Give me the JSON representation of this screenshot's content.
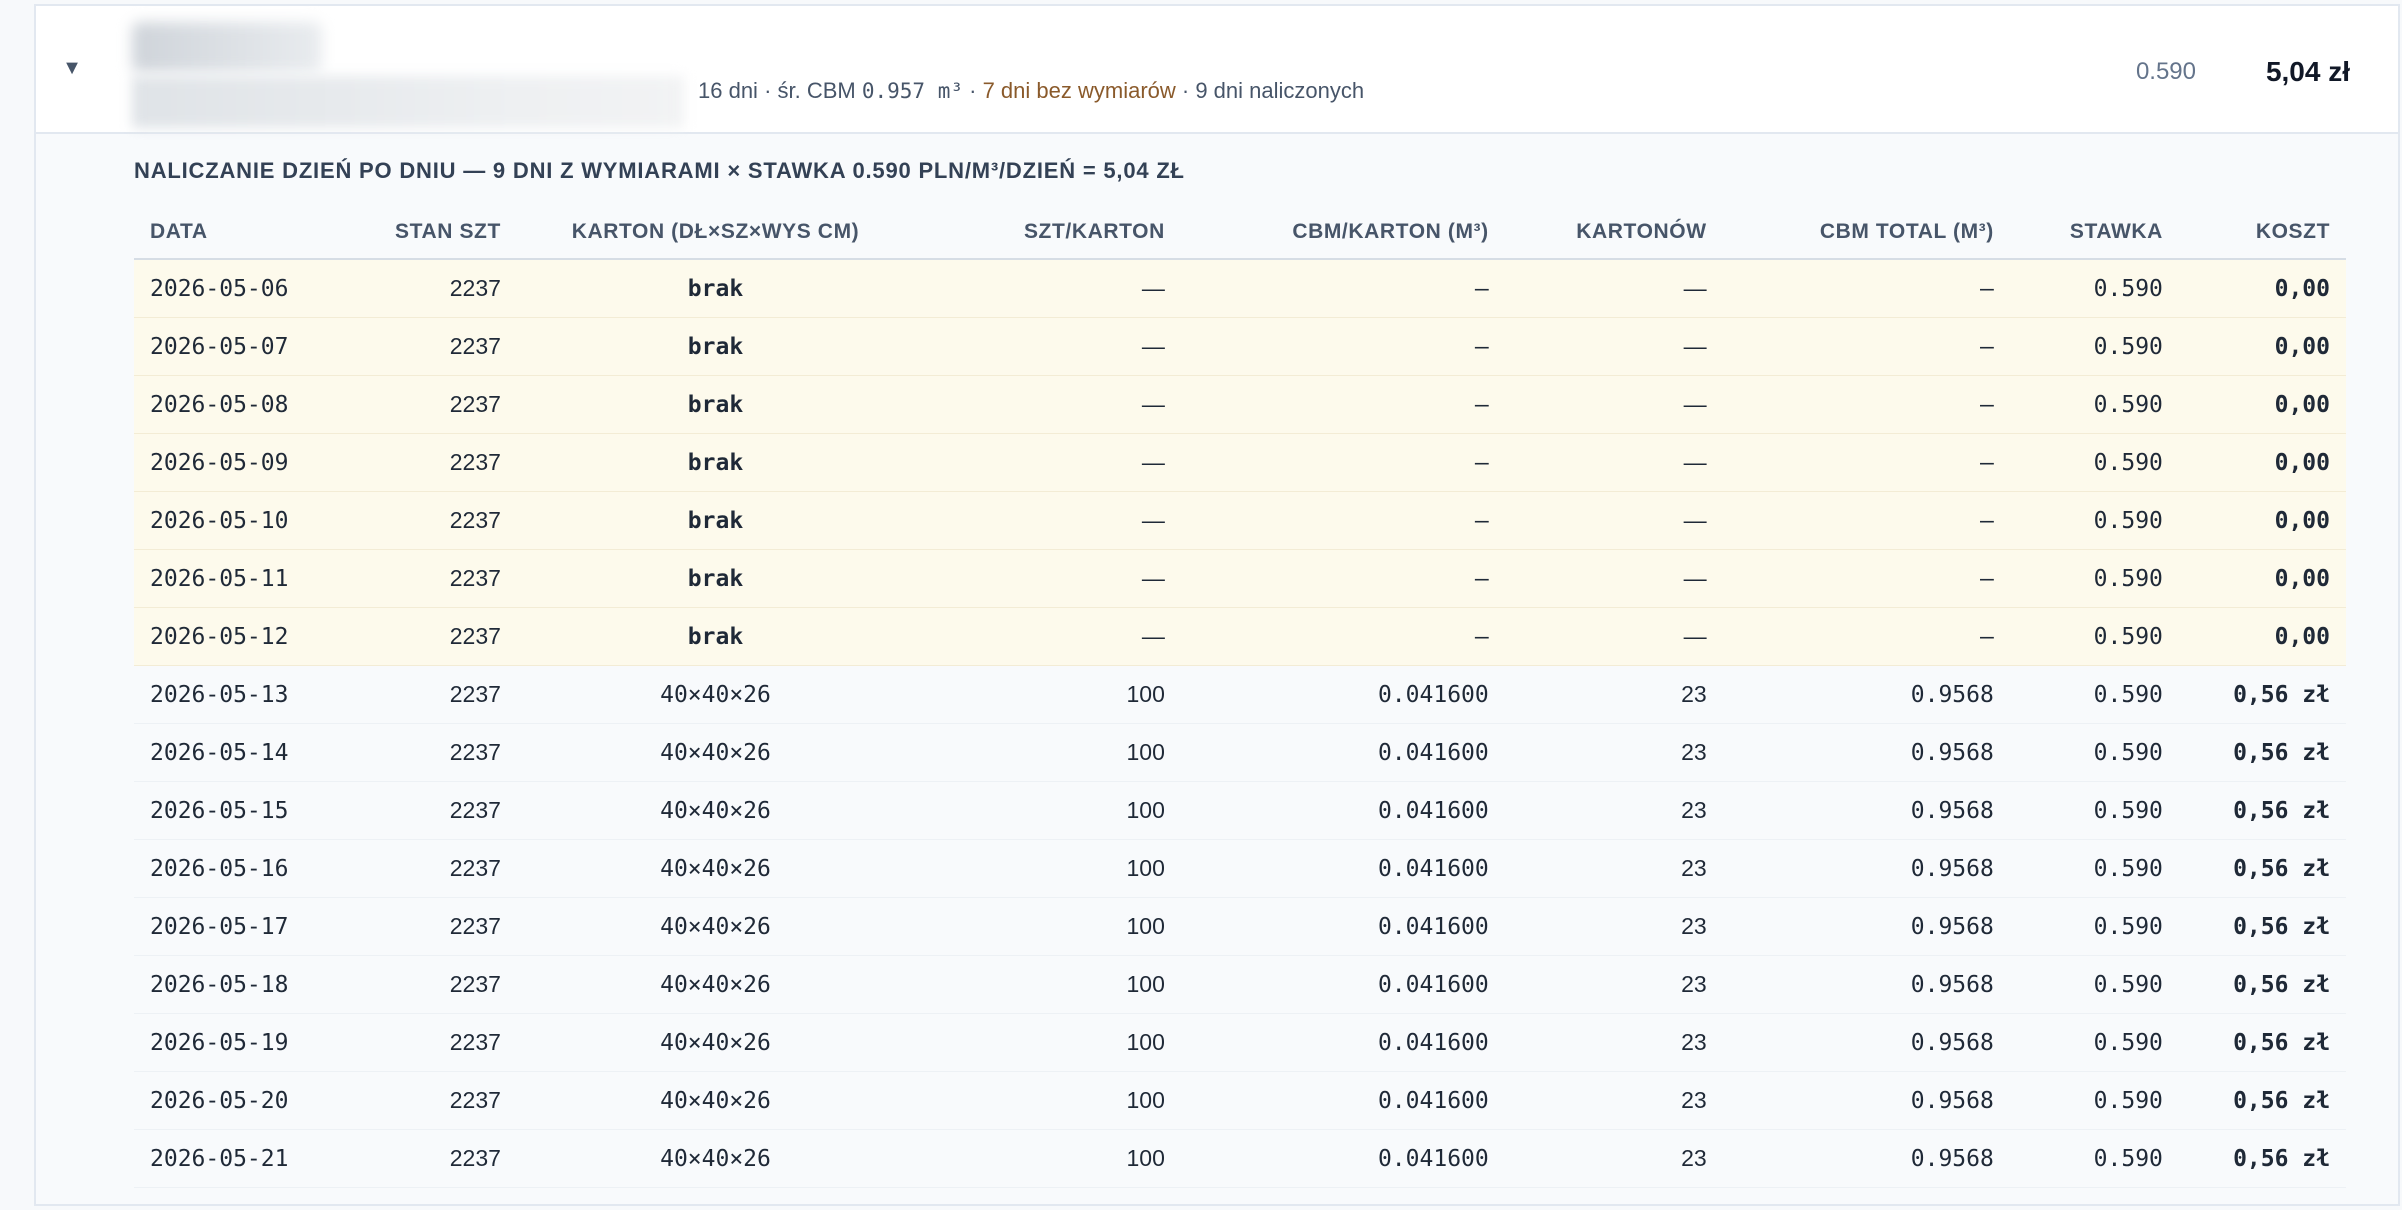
{
  "header": {
    "toggle_glyph": "▼",
    "summary_days": "16 dni",
    "summary_sep1": " · ",
    "summary_avg_label": "śr. CBM ",
    "summary_avg_value": "0.957 m³",
    "summary_sep2": " · ",
    "summary_missing": "7 dni bez wymiarów",
    "summary_sep3": " · ",
    "summary_charged": "9 dni naliczonych",
    "rate": "0.590",
    "total": "5,04 zł"
  },
  "breakdown": {
    "title": "NALICZANIE DZIEŃ PO DNIU — 9 DNI Z WYMIARAMI × STAWKA 0.590 PLN/M³/DZIEŃ = 5,04 ZŁ",
    "columns": [
      "DATA",
      "STAN SZT",
      "KARTON (DŁ×SZ×WYS CM)",
      "SZT/KARTON",
      "CBM/KARTON (M³)",
      "KARTONÓW",
      "CBM TOTAL (M³)",
      "STAWKA",
      "KOSZT"
    ],
    "rows": [
      {
        "date": "2026-05-06",
        "stock": "2237",
        "carton": "brak",
        "per_carton": "—",
        "cbm_carton": "–",
        "cartons": "—",
        "cbm_total": "–",
        "rate": "0.590",
        "cost": "0,00"
      },
      {
        "date": "2026-05-07",
        "stock": "2237",
        "carton": "brak",
        "per_carton": "—",
        "cbm_carton": "–",
        "cartons": "—",
        "cbm_total": "–",
        "rate": "0.590",
        "cost": "0,00"
      },
      {
        "date": "2026-05-08",
        "stock": "2237",
        "carton": "brak",
        "per_carton": "—",
        "cbm_carton": "–",
        "cartons": "—",
        "cbm_total": "–",
        "rate": "0.590",
        "cost": "0,00"
      },
      {
        "date": "2026-05-09",
        "stock": "2237",
        "carton": "brak",
        "per_carton": "—",
        "cbm_carton": "–",
        "cartons": "—",
        "cbm_total": "–",
        "rate": "0.590",
        "cost": "0,00"
      },
      {
        "date": "2026-05-10",
        "stock": "2237",
        "carton": "brak",
        "per_carton": "—",
        "cbm_carton": "–",
        "cartons": "—",
        "cbm_total": "–",
        "rate": "0.590",
        "cost": "0,00"
      },
      {
        "date": "2026-05-11",
        "stock": "2237",
        "carton": "brak",
        "per_carton": "—",
        "cbm_carton": "–",
        "cartons": "—",
        "cbm_total": "–",
        "rate": "0.590",
        "cost": "0,00"
      },
      {
        "date": "2026-05-12",
        "stock": "2237",
        "carton": "brak",
        "per_carton": "—",
        "cbm_carton": "–",
        "cartons": "—",
        "cbm_total": "–",
        "rate": "0.590",
        "cost": "0,00"
      },
      {
        "date": "2026-05-13",
        "stock": "2237",
        "carton": "40×40×26",
        "per_carton": "100",
        "cbm_carton": "0.041600",
        "cartons": "23",
        "cbm_total": "0.9568",
        "rate": "0.590",
        "cost": "0,56 zł"
      },
      {
        "date": "2026-05-14",
        "stock": "2237",
        "carton": "40×40×26",
        "per_carton": "100",
        "cbm_carton": "0.041600",
        "cartons": "23",
        "cbm_total": "0.9568",
        "rate": "0.590",
        "cost": "0,56 zł"
      },
      {
        "date": "2026-05-15",
        "stock": "2237",
        "carton": "40×40×26",
        "per_carton": "100",
        "cbm_carton": "0.041600",
        "cartons": "23",
        "cbm_total": "0.9568",
        "rate": "0.590",
        "cost": "0,56 zł"
      },
      {
        "date": "2026-05-16",
        "stock": "2237",
        "carton": "40×40×26",
        "per_carton": "100",
        "cbm_carton": "0.041600",
        "cartons": "23",
        "cbm_total": "0.9568",
        "rate": "0.590",
        "cost": "0,56 zł"
      },
      {
        "date": "2026-05-17",
        "stock": "2237",
        "carton": "40×40×26",
        "per_carton": "100",
        "cbm_carton": "0.041600",
        "cartons": "23",
        "cbm_total": "0.9568",
        "rate": "0.590",
        "cost": "0,56 zł"
      },
      {
        "date": "2026-05-18",
        "stock": "2237",
        "carton": "40×40×26",
        "per_carton": "100",
        "cbm_carton": "0.041600",
        "cartons": "23",
        "cbm_total": "0.9568",
        "rate": "0.590",
        "cost": "0,56 zł"
      },
      {
        "date": "2026-05-19",
        "stock": "2237",
        "carton": "40×40×26",
        "per_carton": "100",
        "cbm_carton": "0.041600",
        "cartons": "23",
        "cbm_total": "0.9568",
        "rate": "0.590",
        "cost": "0,56 zł"
      },
      {
        "date": "2026-05-20",
        "stock": "2237",
        "carton": "40×40×26",
        "per_carton": "100",
        "cbm_carton": "0.041600",
        "cartons": "23",
        "cbm_total": "0.9568",
        "rate": "0.590",
        "cost": "0,56 zł"
      },
      {
        "date": "2026-05-21",
        "stock": "2237",
        "carton": "40×40×26",
        "per_carton": "100",
        "cbm_carton": "0.041600",
        "cartons": "23",
        "cbm_total": "0.9568",
        "rate": "0.590",
        "cost": "0,56 zł"
      }
    ]
  }
}
